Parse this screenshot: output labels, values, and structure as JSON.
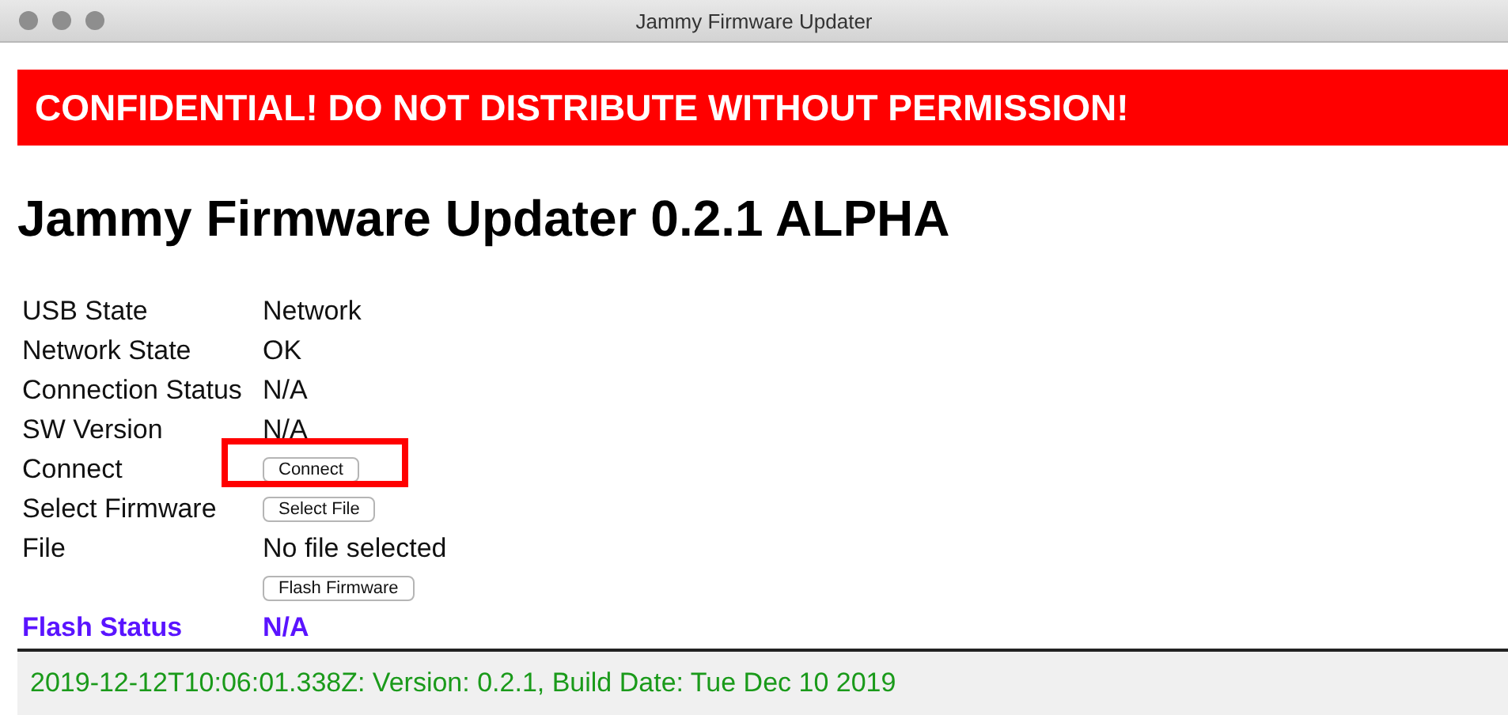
{
  "window": {
    "title": "Jammy Firmware Updater"
  },
  "banner": "CONFIDENTIAL! DO NOT DISTRIBUTE WITHOUT PERMISSION!",
  "heading": "Jammy Firmware Updater 0.2.1 ALPHA",
  "rows": [
    {
      "kind": "text",
      "label": "USB State",
      "value": "Network",
      "annotated": false
    },
    {
      "kind": "text",
      "label": "Network State",
      "value": "OK",
      "annotated": false
    },
    {
      "kind": "text",
      "label": "Connection Status",
      "value": "N/A",
      "annotated": false
    },
    {
      "kind": "text",
      "label": "SW Version",
      "value": "N/A",
      "annotated": false
    },
    {
      "kind": "button",
      "label": "Connect",
      "value": "Connect",
      "annotated": true
    },
    {
      "kind": "button",
      "label": "Select Firmware",
      "value": "Select File",
      "annotated": false
    },
    {
      "kind": "text",
      "label": "File",
      "value": "No file selected",
      "annotated": false
    },
    {
      "kind": "button",
      "value": "Flash Firmware",
      "annotated": false
    },
    {
      "kind": "status",
      "label": "Flash Status",
      "value": "N/A",
      "annotated": false
    }
  ],
  "footer": "2019-12-12T10:06:01.338Z: Version: 0.2.1, Build Date: Tue Dec 10 2019"
}
